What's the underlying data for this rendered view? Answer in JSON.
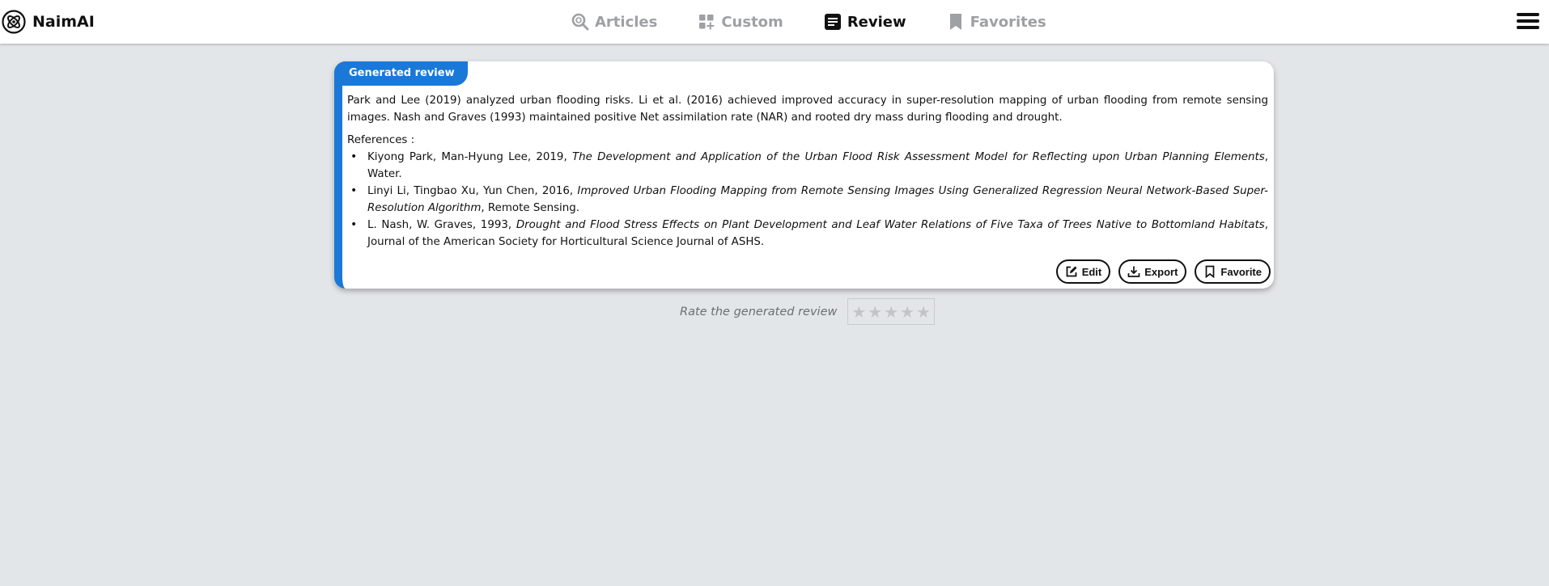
{
  "header": {
    "brand": {
      "name": "NaimAI",
      "icon": "naimai-logo-icon"
    },
    "nav": [
      {
        "label": "Articles",
        "icon": "search-articles-icon",
        "active": false
      },
      {
        "label": "Custom",
        "icon": "grid-plus-icon",
        "active": false
      },
      {
        "label": "Review",
        "icon": "document-icon",
        "active": true
      },
      {
        "label": "Favorites",
        "icon": "bookmark-icon",
        "active": false
      }
    ],
    "menu_icon": "hamburger-menu-icon"
  },
  "review": {
    "tag": "Generated review",
    "summary": "Park and Lee (2019) analyzed urban flooding risks. Li et al. (2016) achieved improved accuracy in super-resolution mapping of urban flooding from remote sensing images. Nash and Graves (1993) maintained positive Net assimilation rate (NAR) and rooted dry mass during flooding and drought.",
    "references_title": "References :",
    "references": [
      {
        "authors": "Kiyong Park, Man-Hyung Lee, 2019,",
        "title": "The Development and Application of the Urban Flood Risk Assessment Model for Reflecting upon Urban Planning Elements",
        "venue": ", Water."
      },
      {
        "authors": "Linyi Li, Tingbao Xu, Yun Chen, 2016,",
        "title": "Improved Urban Flooding Mapping from Remote Sensing Images Using Generalized Regression Neural Network-Based Super-Resolution Algorithm",
        "venue": ", Remote Sensing."
      },
      {
        "authors": "L. Nash, W. Graves, 1993,",
        "title": "Drought and Flood Stress Effects on Plant Development and Leaf Water Relations of Five Taxa of Trees Native to Bottomland Habitats",
        "venue": ", Journal of the American Society for Horticultural Science Journal of ASHS."
      }
    ],
    "actions": {
      "edit": "Edit",
      "export": "Export",
      "favorite": "Favorite"
    },
    "accent_color": "#1a78d8"
  },
  "rating": {
    "label": "Rate the generated review",
    "stars": [
      "★",
      "★",
      "★",
      "★",
      "★"
    ],
    "value": 0
  }
}
